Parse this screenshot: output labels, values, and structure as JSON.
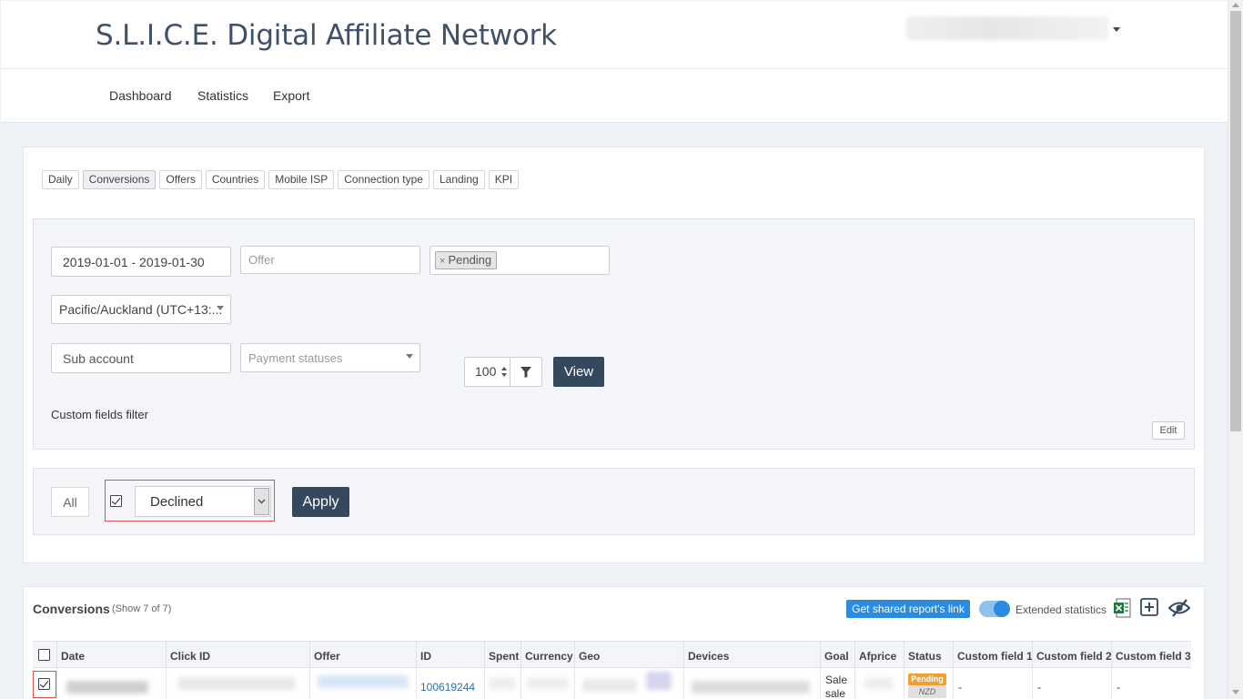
{
  "header": {
    "brand": "S.L.I.C.E. Digital Affiliate Network"
  },
  "nav": {
    "items": [
      "Dashboard",
      "Statistics",
      "Export"
    ]
  },
  "report_tabs": [
    "Daily",
    "Conversions",
    "Offers",
    "Countries",
    "Mobile ISP",
    "Connection type",
    "Landing",
    "KPI"
  ],
  "active_tab": "Conversions",
  "filters": {
    "date_range": "2019-01-01 - 2019-01-30",
    "offer_placeholder": "Offer",
    "status_tag": "Pending",
    "timezone": "Pacific/Auckland (UTC+13:...",
    "sub_account_placeholder": "Sub account",
    "payment_statuses_placeholder": "Payment statuses",
    "per_page": "100",
    "view_label": "View",
    "custom_fields_label": "Custom fields filter",
    "edit_label": "Edit"
  },
  "bulk": {
    "all_label": "All",
    "status_value": "Declined",
    "apply_label": "Apply"
  },
  "conversions": {
    "title": "Conversions",
    "count_text": "(Show 7 of 7)",
    "share_label": "Get shared report's link",
    "extended_label": "Extended statistics",
    "columns": [
      "Date",
      "Click ID",
      "Offer",
      "ID",
      "Spent",
      "Currency",
      "Geo",
      "Devices",
      "Goal",
      "Afprice",
      "Status",
      "Custom field 1",
      "Custom field 2",
      "Custom field 3"
    ],
    "rows": [
      {
        "id": "100619244",
        "goal_line1": "Sale",
        "goal_line2": "sale",
        "status": "Pending",
        "currency_badge": "NZD",
        "custom1": "-",
        "custom2": "-",
        "custom3": "-"
      }
    ]
  },
  "colors": {
    "dark_button": "#34495e",
    "link_blue": "#2a8be0",
    "pending_orange": "#f0a030",
    "highlight_red": "#d9534f"
  }
}
